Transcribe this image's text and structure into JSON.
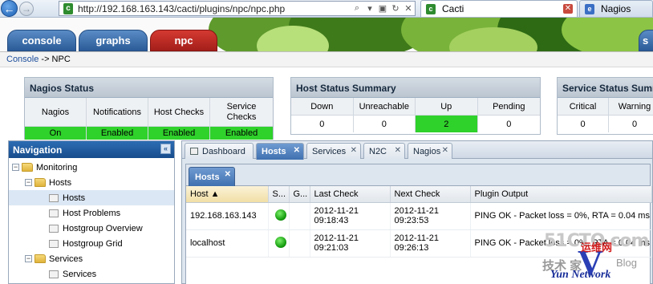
{
  "browser": {
    "back_icon": "←",
    "forward_icon": "→",
    "url": "http://192.168.163.143/cacti/plugins/npc/npc.php",
    "tabs": [
      {
        "title": "Cacti"
      },
      {
        "title": "Nagios"
      }
    ]
  },
  "cacti": {
    "tabs": [
      "console",
      "graphs",
      "npc",
      "s"
    ],
    "breadcrumb": {
      "link": "Console",
      "rest": " -> NPC"
    }
  },
  "nagios_status": {
    "title": "Nagios Status",
    "headers": [
      "Nagios",
      "Notifications",
      "Host Checks",
      "Service Checks"
    ],
    "values": [
      "On",
      "Enabled",
      "Enabled",
      "Enabled"
    ]
  },
  "host_summary": {
    "title": "Host Status Summary",
    "headers": [
      "Down",
      "Unreachable",
      "Up",
      "Pending"
    ],
    "values": [
      "0",
      "0",
      "2",
      "0"
    ],
    "highlight_color": "#2fd12b"
  },
  "service_summary": {
    "title": "Service Status Summ",
    "headers": [
      "Critical",
      "Warning"
    ],
    "values": [
      "0",
      "0"
    ]
  },
  "navigation": {
    "title": "Navigation",
    "collapse_icon": "«",
    "tree": [
      {
        "label": "Monitoring",
        "type": "folder",
        "expander": "−"
      },
      {
        "label": "Hosts",
        "type": "folder",
        "expander": "−"
      },
      {
        "label": "Hosts",
        "type": "leaf"
      },
      {
        "label": "Host Problems",
        "type": "leaf"
      },
      {
        "label": "Hostgroup Overview",
        "type": "leaf"
      },
      {
        "label": "Hostgroup Grid",
        "type": "leaf"
      },
      {
        "label": "Services",
        "type": "folder",
        "expander": "−"
      },
      {
        "label": "Services",
        "type": "leaf"
      }
    ]
  },
  "main_tabs": [
    {
      "label": "Dashboard"
    },
    {
      "label": "Hosts"
    },
    {
      "label": "Services"
    },
    {
      "label": "N2C"
    },
    {
      "label": "Nagios"
    }
  ],
  "hosts_panel": {
    "tab_label": "Hosts",
    "columns": [
      "Host ▲",
      "S...",
      "G...",
      "Last Check",
      "Next Check",
      "Plugin Output"
    ],
    "rows": [
      {
        "host": "192.168.163.143",
        "last_check": [
          "2012-11-21",
          "09:18:43"
        ],
        "next_check": [
          "2012-11-21",
          "09:23:53"
        ],
        "output": "PING OK - Packet loss = 0%, RTA = 0.04 ms"
      },
      {
        "host": "localhost",
        "last_check": [
          "2012-11-21",
          "09:21:03"
        ],
        "next_check": [
          "2012-11-21",
          "09:26:13"
        ],
        "output": "PING OK - Packet loss = 0%, RTA = 0.04 ms"
      }
    ]
  },
  "watermark": {
    "top": "51CTO.com",
    "cn": "技术  家",
    "blog": "Blog",
    "net": "Yun Network",
    "red": "运维网"
  },
  "colors": {
    "accent_blue": "#2d6db3",
    "status_ok": "#2fd12b",
    "npc_tab": "#c42b25"
  }
}
